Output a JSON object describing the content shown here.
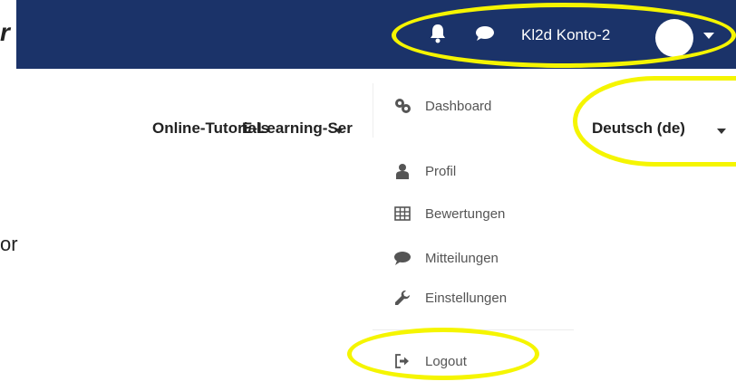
{
  "navbar": {
    "left_fragment": "r",
    "user_name": "Kl2d Konto-2",
    "icons": [
      "bell-icon",
      "chat-icon"
    ],
    "background": "#1b3369"
  },
  "secondary_nav": {
    "tutorials_label": "Online-Tutorials",
    "elearning_label": "E-Learning-Ser",
    "language_label": "Deutsch (de)"
  },
  "body": {
    "left_fragment": "or"
  },
  "user_menu": {
    "items": [
      {
        "label": "Dashboard",
        "icon": "dashboard-icon"
      },
      {
        "label": "Profil",
        "icon": "user-icon"
      },
      {
        "label": "Bewertungen",
        "icon": "table-icon"
      },
      {
        "label": "Mitteilungen",
        "icon": "chat-icon"
      },
      {
        "label": "Einstellungen",
        "icon": "wrench-icon"
      },
      {
        "label": "Logout",
        "icon": "sign-out-icon"
      }
    ]
  },
  "highlight_color": "#f5f500"
}
